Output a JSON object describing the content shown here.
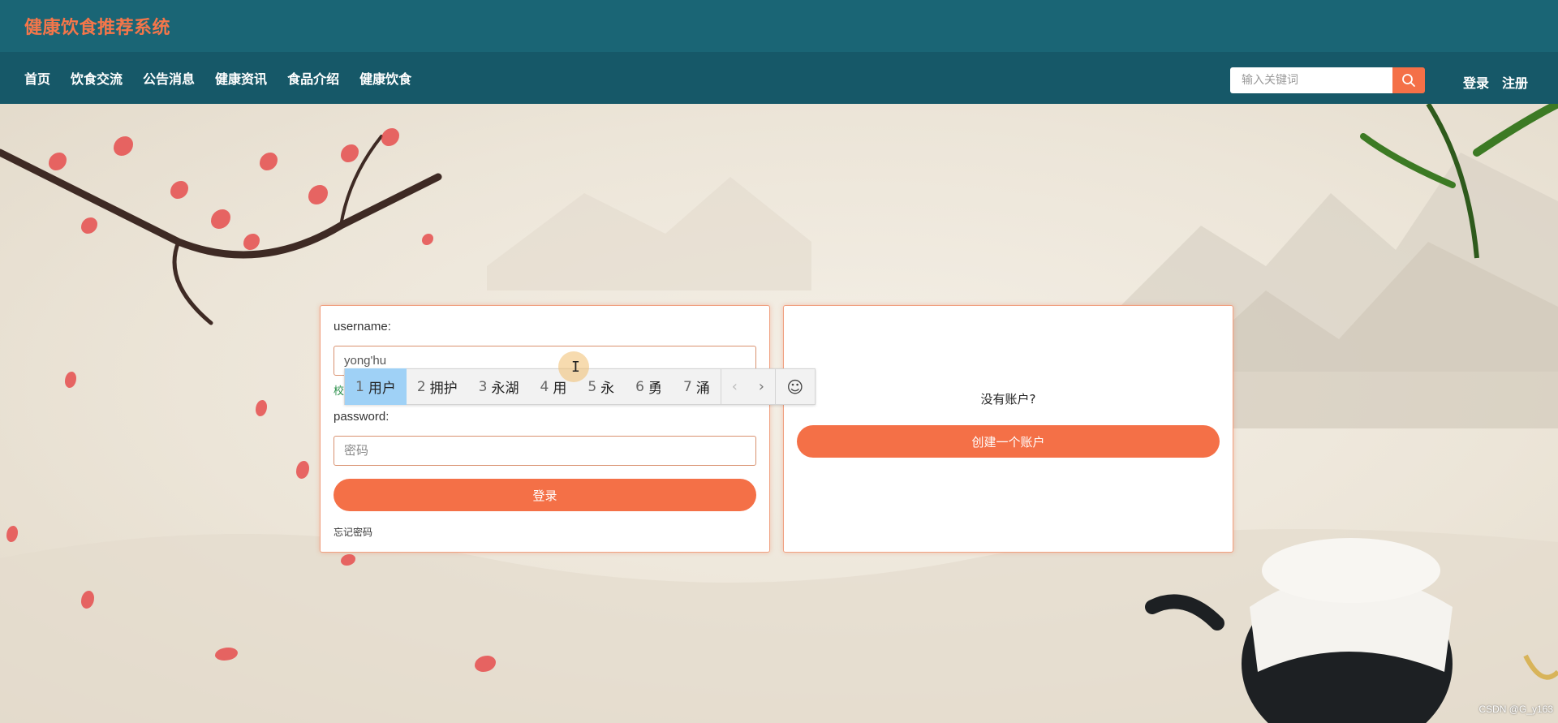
{
  "header": {
    "site_title": "健康饮食推荐系统"
  },
  "nav": {
    "items": [
      "首页",
      "饮食交流",
      "公告消息",
      "健康资讯",
      "食品介绍",
      "健康饮食"
    ],
    "search_placeholder": "输入关键词",
    "login": "登录",
    "register": "注册"
  },
  "login_form": {
    "username_label": "username:",
    "username_value": "yong'hu",
    "validate_hint": "校",
    "password_label": "password:",
    "password_placeholder": "密码",
    "submit_label": "登录",
    "forgot_label": "忘记密码"
  },
  "register_panel": {
    "prompt": "没有账户?",
    "create_label": "创建一个账户"
  },
  "ime": {
    "candidates": [
      {
        "num": "1",
        "text": "用户"
      },
      {
        "num": "2",
        "text": "拥护"
      },
      {
        "num": "3",
        "text": "永湖"
      },
      {
        "num": "4",
        "text": "用"
      },
      {
        "num": "5",
        "text": "永"
      },
      {
        "num": "6",
        "text": "勇"
      },
      {
        "num": "7",
        "text": "涌"
      }
    ],
    "prev": "‹",
    "next": "›",
    "emoji": "☺"
  },
  "watermark": "CSDN @G_y163",
  "colors": {
    "topbar": "#1a6575",
    "navbar": "#165868",
    "accent": "#f47047",
    "title": "#f4764a"
  }
}
